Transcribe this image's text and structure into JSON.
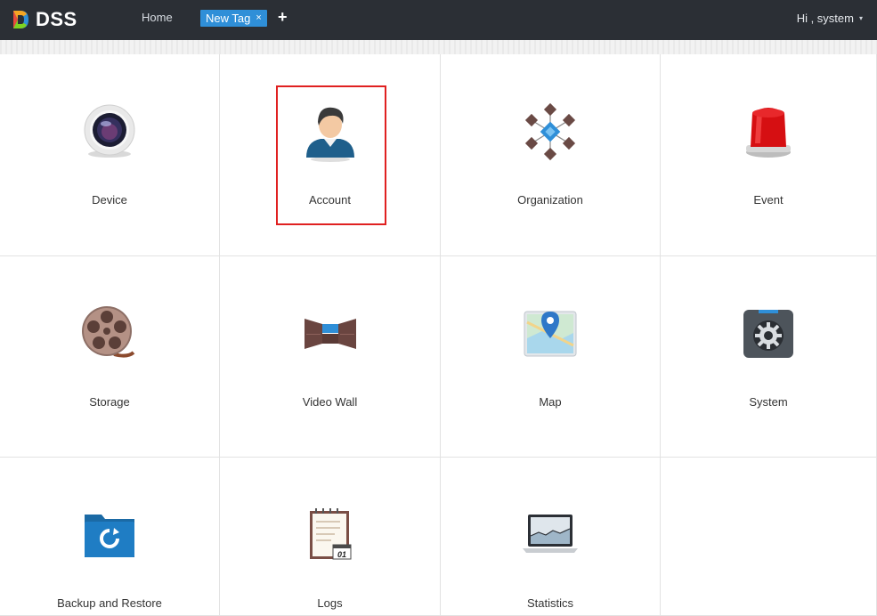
{
  "header": {
    "logo_text": "DSS",
    "home_label": "Home",
    "tab_label": "New Tag",
    "tab_close": "×",
    "add_tab": "+",
    "user_label": "Hi , system",
    "user_caret": "▾"
  },
  "tiles": [
    {
      "label": "Device",
      "icon": "device-icon"
    },
    {
      "label": "Account",
      "icon": "account-icon"
    },
    {
      "label": "Organization",
      "icon": "organization-icon"
    },
    {
      "label": "Event",
      "icon": "event-alarm-icon"
    },
    {
      "label": "Storage",
      "icon": "storage-reel-icon"
    },
    {
      "label": "Video Wall",
      "icon": "video-wall-icon"
    },
    {
      "label": "Map",
      "icon": "map-pin-icon"
    },
    {
      "label": "System",
      "icon": "system-gear-icon"
    },
    {
      "label": "Backup and Restore",
      "icon": "backup-folder-icon"
    },
    {
      "label": "Logs",
      "icon": "logs-notepad-icon"
    },
    {
      "label": "Statistics",
      "icon": "statistics-laptop-icon"
    }
  ],
  "logs_icon_date": "01",
  "colors": {
    "topbar": "#2b2f35",
    "tab": "#2f8fd8",
    "highlight": "#e02020"
  }
}
